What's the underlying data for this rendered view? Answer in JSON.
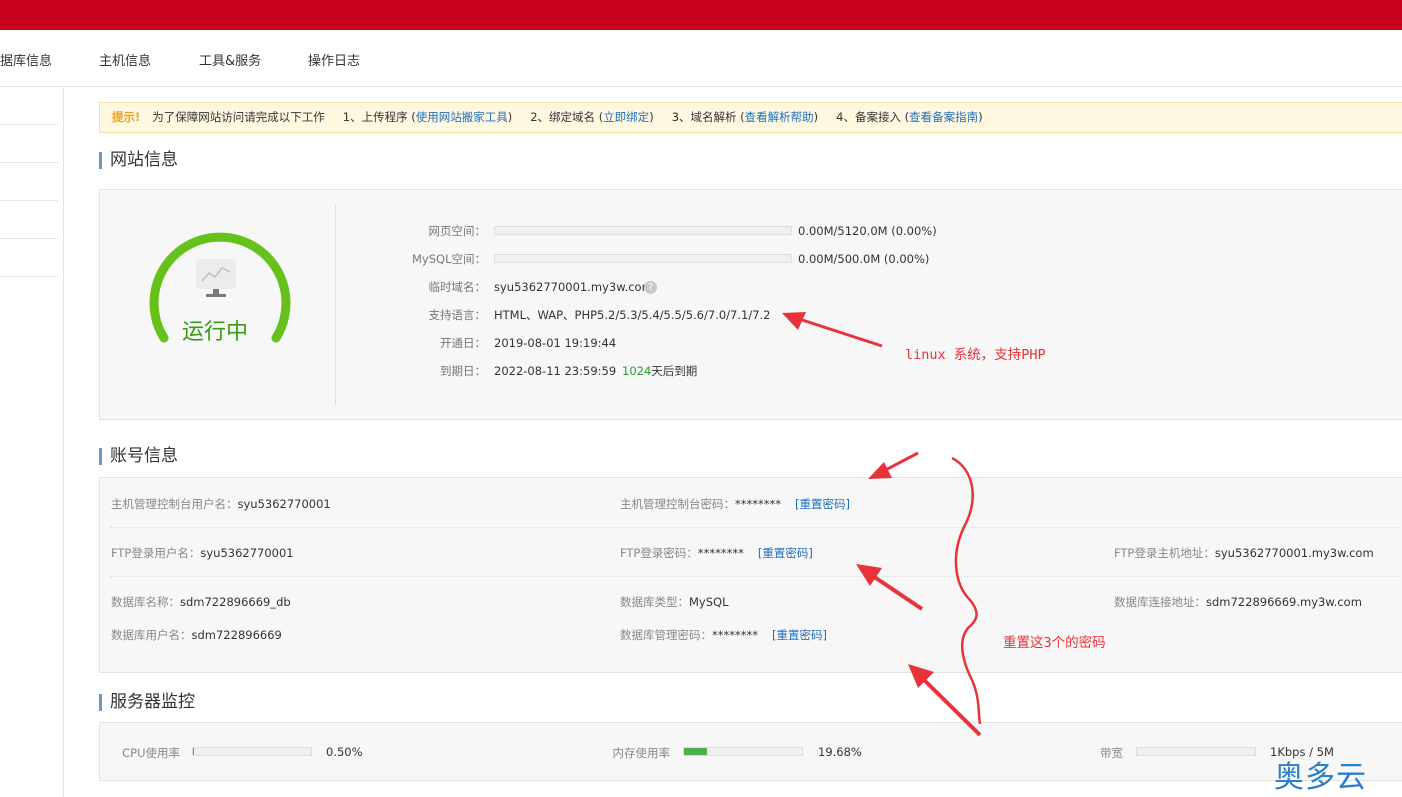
{
  "nav": {
    "items": [
      "据库信息",
      "主机信息",
      "工具&服务",
      "操作日志"
    ]
  },
  "tip": {
    "label": "提示!",
    "intro": "为了保障网站访问请完成以下工作",
    "step1": "1、上传程序 (",
    "step1_link": "使用网站搬家工具",
    "step2": "2、绑定域名 (",
    "step2_link": "立即绑定",
    "step3": "3、域名解析 (",
    "step3_link": "查看解析帮助",
    "step4": "4、备案接入 (",
    "step4_link": "查看备案指南",
    "close_paren": ")"
  },
  "site": {
    "title": "网站信息",
    "status": "运行中",
    "web_space_label": "网页空间：",
    "web_space_value": "0.00M/5120.0M (0.00%)",
    "web_space_fraction": 0,
    "mysql_space_label": "MySQL空间：",
    "mysql_space_value": "0.00M/500.0M (0.00%)",
    "mysql_space_fraction": 0,
    "temp_domain_label": "临时域名：",
    "temp_domain_value": "syu5362770001.my3w.com",
    "help_glyph": "?",
    "lang_label": "支持语言：",
    "lang_value": "HTML、WAP、PHP5.2/5.3/5.4/5.5/5.6/7.0/7.1/7.2",
    "open_label": "开通日：",
    "open_value": "2019-08-01 19:19:44",
    "expire_label": "到期日：",
    "expire_value": "2022-08-11 23:59:59",
    "days_left": "1024",
    "days_suffix": "天后到期"
  },
  "account": {
    "title": "账号信息",
    "console_user_label": "主机管理控制台用户名：",
    "console_user_value": "syu5362770001",
    "console_pwd_label": "主机管理控制台密码：",
    "console_pwd_value": "********",
    "reset_link": "[重置密码]",
    "ftp_user_label": "FTP登录用户名：",
    "ftp_user_value": "syu5362770001",
    "ftp_pwd_label": "FTP登录密码：",
    "ftp_pwd_value": "********",
    "ftp_host_label": "FTP登录主机地址：",
    "ftp_host_value": "syu5362770001.my3w.com",
    "db_name_label": "数据库名称：",
    "db_name_value": "sdm722896669_db",
    "db_type_label": "数据库类型：",
    "db_type_value": "MySQL",
    "db_host_label": "数据库连接地址：",
    "db_host_value": "sdm722896669.my3w.com",
    "db_user_label": "数据库用户名：",
    "db_user_value": "sdm722896669",
    "db_pwd_label": "数据库管理密码：",
    "db_pwd_value": "********"
  },
  "monitor": {
    "title": "服务器监控",
    "cpu_label": "CPU使用率",
    "cpu_value": "0.50%",
    "cpu_fraction": 0.005,
    "mem_label": "内存使用率",
    "mem_value": "19.68%",
    "mem_fraction": 0.1968,
    "bw_label": "带宽",
    "bw_value": "1Kbps / 5M",
    "bw_fraction": 0
  },
  "annotations": {
    "note1": "linux 系统，支持PHP",
    "note2": "重置这3个的密码",
    "color": "#e8333a"
  },
  "watermark": "奥多云",
  "colors": {
    "topbar": "#c8001c",
    "link": "#1f6fbf",
    "running": "#3a9b16",
    "gauge": "#66c21a"
  },
  "icons": {
    "gauge_center": "monitor-chart-icon",
    "help": "question-circle-icon"
  }
}
